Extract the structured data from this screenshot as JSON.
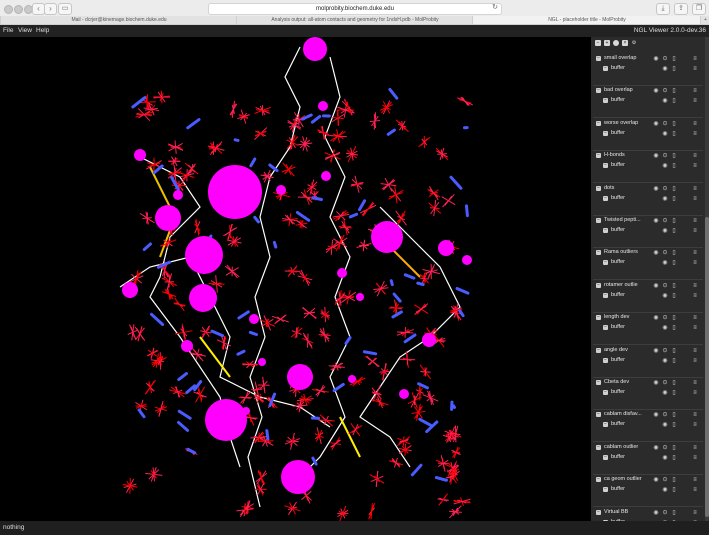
{
  "browser": {
    "url": "molprobity.biochem.duke.edu",
    "tabs": [
      {
        "label": "Mail - dcrjer@kinemage.biochem.duke.edu",
        "active": false
      },
      {
        "label": "Analysis output: all-atom contacts and geometry for 1ndsH.pdb - MolProbity",
        "active": false
      },
      {
        "label": "NGL - placeholder title - MolProbity",
        "active": true
      }
    ],
    "back_icon": "chevron-left-icon",
    "forward_icon": "chevron-right-icon"
  },
  "appbar": {
    "menu": [
      "File",
      "View",
      "Help"
    ],
    "title": "NGL Viewer 2.0.0-dev.36"
  },
  "sidebar": {
    "toolbar_icons": [
      "collapse-icon",
      "expand-icon",
      "center-icon",
      "delete-icon",
      "settings-icon"
    ],
    "components": [
      {
        "name": "small overlap",
        "rep": "buffer"
      },
      {
        "name": "bad overlap",
        "rep": "buffer"
      },
      {
        "name": "worse overlap",
        "rep": "buffer"
      },
      {
        "name": "H-bonds",
        "rep": "buffer"
      },
      {
        "name": "dots",
        "rep": "buffer"
      },
      {
        "name": "Twisted pepti...",
        "rep": "buffer"
      },
      {
        "name": "Rama outliers",
        "rep": "buffer"
      },
      {
        "name": "rotamer outlie",
        "rep": "buffer"
      },
      {
        "name": "length dev",
        "rep": "buffer"
      },
      {
        "name": "angle dev",
        "rep": "buffer"
      },
      {
        "name": "Cbeta dev",
        "rep": "buffer"
      },
      {
        "name": "cablam disfav...",
        "rep": "buffer"
      },
      {
        "name": "cablam outlier",
        "rep": "buffer"
      },
      {
        "name": "ca geom outlier",
        "rep": "buffer"
      },
      {
        "name": "Virtual BB",
        "rep": "buffer"
      }
    ]
  },
  "status": {
    "text": "nothing"
  },
  "colors": {
    "outlier_sphere": "#ff00ff",
    "clash_spikes": "#ff2255",
    "backbone": "#ffffff",
    "sidebar_bg": "#2b2b2b"
  }
}
